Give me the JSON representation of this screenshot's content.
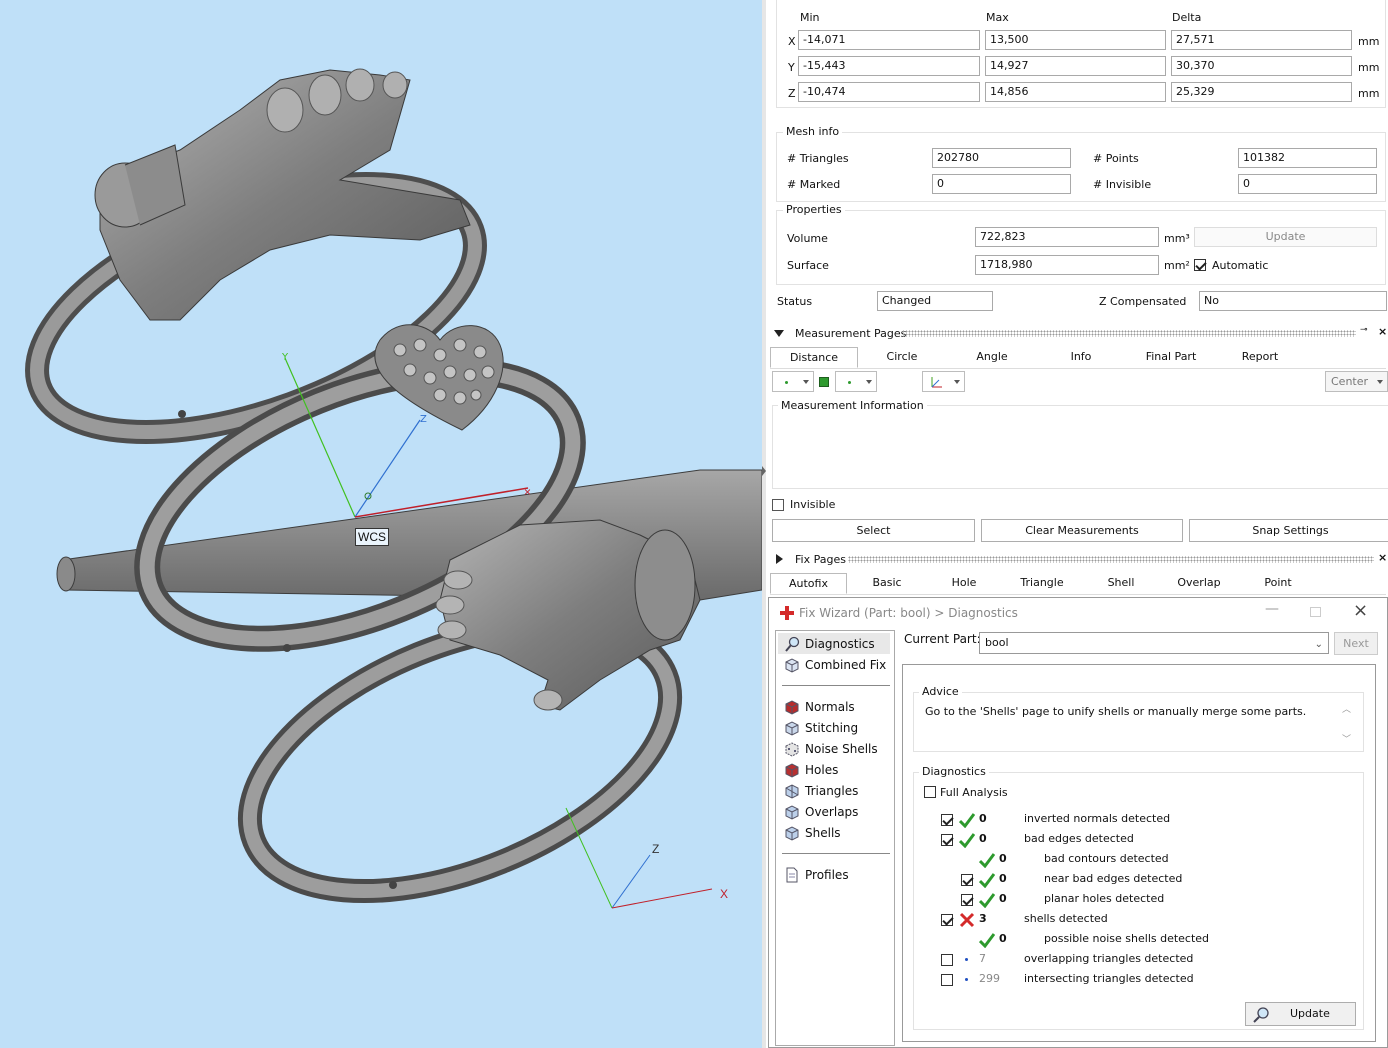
{
  "viewport": {
    "wcs_label": "WCS",
    "axis_x": "X",
    "axis_y": "Y",
    "axis_z": "Z"
  },
  "dimensions": {
    "header_min": "Min",
    "header_max": "Max",
    "header_delta": "Delta",
    "unit": "mm",
    "rows": [
      {
        "axis": "X",
        "min": "-14,071",
        "max": "13,500",
        "delta": "27,571"
      },
      {
        "axis": "Y",
        "min": "-15,443",
        "max": "14,927",
        "delta": "30,370"
      },
      {
        "axis": "Z",
        "min": "-10,474",
        "max": "14,856",
        "delta": "25,329"
      }
    ]
  },
  "mesh_info": {
    "title": "Mesh info",
    "triangles_label": "# Triangles",
    "triangles": "202780",
    "points_label": "# Points",
    "points": "101382",
    "marked_label": "# Marked",
    "marked": "0",
    "invisible_label": "# Invisible",
    "invisible": "0"
  },
  "properties": {
    "title": "Properties",
    "volume_label": "Volume",
    "volume": "722,823",
    "volume_unit": "mm³",
    "update_label": "Update",
    "surface_label": "Surface",
    "surface": "1718,980",
    "surface_unit": "mm²",
    "automatic_label": "Automatic",
    "automatic_checked": true
  },
  "status": {
    "status_label": "Status",
    "status_value": "Changed",
    "zcomp_label": "Z Compensated",
    "zcomp_value": "No"
  },
  "measurement": {
    "title": "Measurement Pages",
    "tabs": [
      "Distance",
      "Circle",
      "Angle",
      "Info",
      "Final Part",
      "Report"
    ],
    "center_label": "Center",
    "info_label": "Measurement Information",
    "invisible_label": "Invisible",
    "select_label": "Select",
    "clear_label": "Clear Measurements",
    "snap_label": "Snap Settings"
  },
  "fix_pages": {
    "title": "Fix Pages",
    "tabs": [
      "Autofix",
      "Basic",
      "Hole",
      "Triangle",
      "Shell",
      "Overlap",
      "Point"
    ]
  },
  "fix_wizard": {
    "title": "Fix Wizard (Part: bool) > Diagnostics",
    "current_part_label": "Current Part:",
    "current_part": "bool",
    "next_label": "Next",
    "sidebar": [
      {
        "label": "Diagnostics",
        "icon": "magnifier-icon"
      },
      {
        "label": "Combined Fix",
        "icon": "cube-icon"
      },
      {
        "label": "Normals",
        "icon": "normals-cube-icon"
      },
      {
        "label": "Stitching",
        "icon": "stitching-cube-icon"
      },
      {
        "label": "Noise Shells",
        "icon": "noise-cube-icon"
      },
      {
        "label": "Holes",
        "icon": "holes-cube-icon"
      },
      {
        "label": "Triangles",
        "icon": "triangles-cube-icon"
      },
      {
        "label": "Overlaps",
        "icon": "overlaps-cube-icon"
      },
      {
        "label": "Shells",
        "icon": "shells-cube-icon"
      },
      {
        "label": "Profiles",
        "icon": "document-icon"
      }
    ],
    "advice_title": "Advice",
    "advice_text": "Go to the 'Shells' page to unify shells or manually merge some parts.",
    "diagnostics_title": "Diagnostics",
    "full_analysis_label": "Full Analysis",
    "update_label": "Update",
    "rows": [
      {
        "count": "0",
        "label": "inverted normals detected",
        "status": "ok",
        "checkbox": true,
        "checked": true,
        "indent": 0
      },
      {
        "count": "0",
        "label": "bad edges detected",
        "status": "ok",
        "checkbox": true,
        "checked": true,
        "indent": 0
      },
      {
        "count": "0",
        "label": "bad contours detected",
        "status": "ok",
        "checkbox": false,
        "checked": false,
        "indent": 1
      },
      {
        "count": "0",
        "label": "near bad edges detected",
        "status": "ok",
        "checkbox": true,
        "checked": true,
        "indent": 1
      },
      {
        "count": "0",
        "label": "planar holes detected",
        "status": "ok",
        "checkbox": true,
        "checked": true,
        "indent": 1
      },
      {
        "count": "3",
        "label": "shells detected",
        "status": "error",
        "checkbox": true,
        "checked": true,
        "indent": 0
      },
      {
        "count": "0",
        "label": "possible noise shells detected",
        "status": "ok",
        "checkbox": false,
        "checked": false,
        "indent": 1
      },
      {
        "count": "7",
        "label": "overlapping triangles detected",
        "status": "info",
        "checkbox": true,
        "checked": false,
        "indent": 0
      },
      {
        "count": "299",
        "label": "intersecting triangles detected",
        "status": "info",
        "checkbox": true,
        "checked": false,
        "indent": 0
      }
    ]
  },
  "colors": {
    "viewport_bg": "#bfe0f8",
    "ok_green": "#2e9a2e",
    "error_red": "#d42a2a",
    "axis_x": "#c0202a",
    "axis_y": "#40c020",
    "axis_z": "#3070d0"
  }
}
